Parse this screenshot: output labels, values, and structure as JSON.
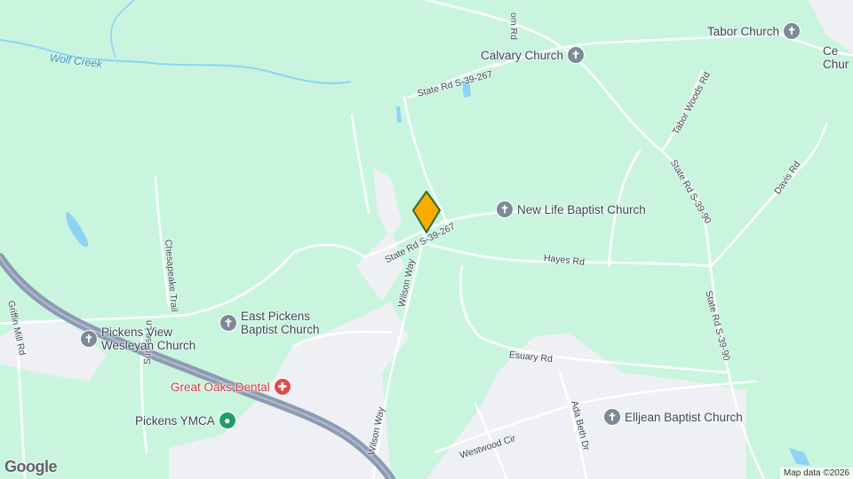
{
  "colors": {
    "land": "#c9f5df",
    "road": "#ffffff",
    "highway": "#8c9bb3",
    "urban": "#eef0f3",
    "water": "#8fd3f4",
    "pin_fill": "#f9ab00",
    "pin_stroke": "#2e6b2e"
  },
  "pois": {
    "tabor_church": {
      "label": "Tabor Church",
      "icon": "cross-icon"
    },
    "calvary_church": {
      "label": "Calvary Church",
      "icon": "cross-icon"
    },
    "partial_church": {
      "line1": "Ce",
      "line2": "Chur",
      "icon": "cross-icon"
    },
    "new_life": {
      "label": "New Life Baptist Church",
      "icon": "cross-icon"
    },
    "east_pickens": {
      "line1": "East Pickens",
      "line2": "Baptist Church",
      "icon": "cross-icon"
    },
    "pickens_view": {
      "line1": "Pickens View",
      "line2": "Wesleyan Church",
      "icon": "cross-icon"
    },
    "great_oaks": {
      "label": "Great Oaks Dental",
      "icon": "medical-icon"
    },
    "pickens_ymca": {
      "label": "Pickens YMCA",
      "icon": "fitness-icon"
    },
    "elljean": {
      "label": "Elljean Baptist Church",
      "icon": "cross-icon"
    }
  },
  "roads": {
    "state_rd_267_north": "State Rd S-39-267",
    "state_rd_267_pin": "State Rd S-39-267",
    "tabor_woods": "Tabor Woods Rd",
    "state_rd_90_upper": "State Rd S-39-90",
    "state_rd_90_lower": "State Rd S-39-90",
    "davis": "Davis Rd",
    "hayes": "Hayes Rd",
    "wilson_upper": "Wilson Way",
    "wilson_lower": "Wilson Way",
    "chesapeake": "Chesapeake Trail",
    "griffin_mill": "Griffin Mill Rd",
    "sunrise": "Sunrise Ln",
    "esuary": "Esuary Rd",
    "ada_beth": "Ada Beth Dr",
    "westwood": "Westwood Cir",
    "top_partial": "om Rd"
  },
  "water": {
    "wolf_creek": "Wolf Creek"
  },
  "logo": "Google",
  "attribution": "Map data ©2026"
}
